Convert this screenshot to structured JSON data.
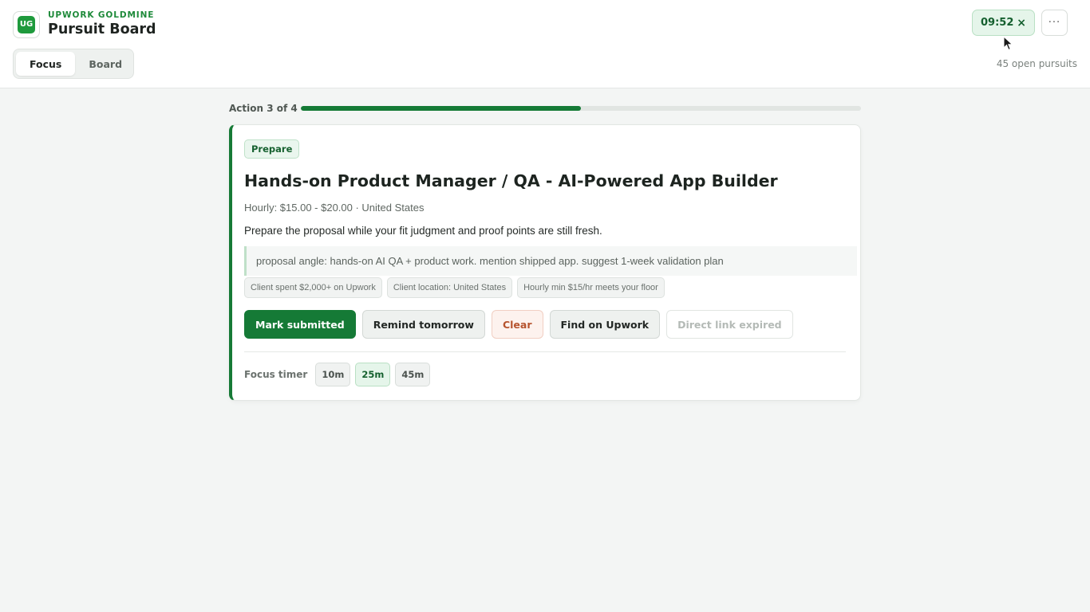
{
  "header": {
    "logo_text": "UG",
    "kicker": "UPWORK GOLDMINE",
    "title": "Pursuit Board",
    "tabs": [
      {
        "label": "Focus",
        "active": true
      },
      {
        "label": "Board",
        "active": false
      }
    ],
    "timer": {
      "value": "09:52",
      "close_glyph": "×"
    },
    "more_glyph": "···",
    "open_count": "45 open pursuits"
  },
  "progress": {
    "label": "Action 3 of 4",
    "fraction": 0.5
  },
  "card": {
    "stage": "Prepare",
    "title": "Hands-on Product Manager / QA - AI-Powered App Builder",
    "meta": "Hourly: $15.00 - $20.00 · United States",
    "description": "Prepare the proposal while your fit judgment and proof points are still fresh.",
    "angle": "proposal angle: hands-on AI QA + product work. mention shipped app. suggest 1-week validation plan",
    "chips": [
      "Client spent $2,000+ on Upwork",
      "Client location: United States",
      "Hourly min $15/hr meets your floor"
    ],
    "actions": {
      "mark_submitted": "Mark submitted",
      "remind_tomorrow": "Remind tomorrow",
      "clear": "Clear",
      "find": "Find on Upwork",
      "direct_link": "Direct link expired"
    },
    "focus_timer": {
      "label": "Focus timer",
      "options": [
        "10m",
        "25m",
        "45m"
      ],
      "selected": "25m"
    }
  },
  "colors": {
    "accent": "#157a36",
    "brand_green": "#1e9a3c",
    "danger_text": "#b6532e"
  }
}
